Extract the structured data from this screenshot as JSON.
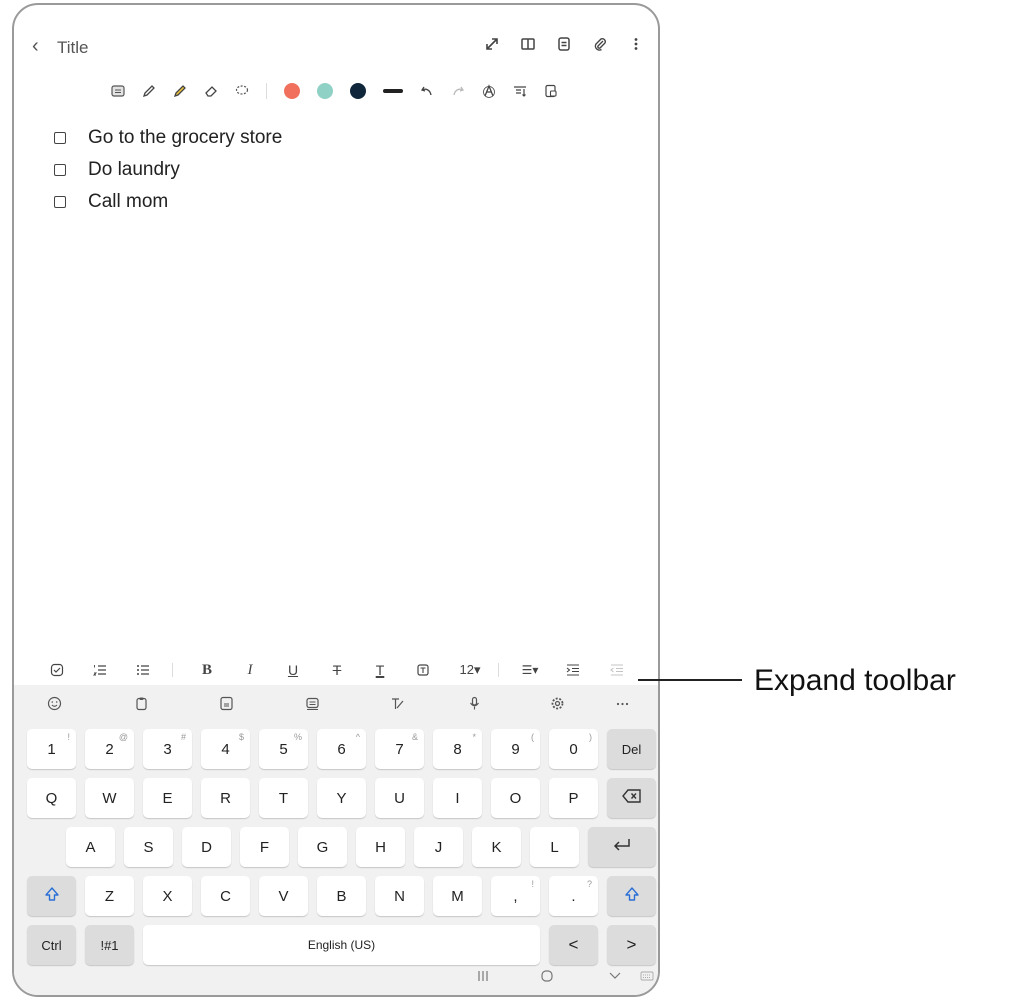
{
  "header": {
    "back_label": "‹",
    "title": "Title",
    "icons": [
      "expand-icon",
      "book-icon",
      "template-icon",
      "attach-icon",
      "more-vert-icon"
    ]
  },
  "draw_toolbar": {
    "icons": [
      "keyboard-mode-icon",
      "pen-icon",
      "highlighter-icon",
      "eraser-icon",
      "lasso-icon",
      "undo-icon",
      "redo-icon",
      "handwriting-icon",
      "text-convert-icon",
      "lock-icon"
    ],
    "colors": [
      "#f0705d",
      "#8fd1c4",
      "#10263a"
    ]
  },
  "note": {
    "items": [
      {
        "text": "Go to the grocery store",
        "checked": false
      },
      {
        "text": "Do laundry",
        "checked": false
      },
      {
        "text": "Call mom",
        "checked": false
      }
    ]
  },
  "format_toolbar": {
    "bold": "B",
    "italic": "I",
    "underline": "U",
    "strike": "T",
    "text_color": "T",
    "font_size": "12▾",
    "align": "☰▾"
  },
  "keyboard": {
    "row1": [
      {
        "k": "1",
        "s": "!"
      },
      {
        "k": "2",
        "s": "@"
      },
      {
        "k": "3",
        "s": "#"
      },
      {
        "k": "4",
        "s": "$"
      },
      {
        "k": "5",
        "s": "%"
      },
      {
        "k": "6",
        "s": "^"
      },
      {
        "k": "7",
        "s": "&"
      },
      {
        "k": "8",
        "s": "*"
      },
      {
        "k": "9",
        "s": "("
      },
      {
        "k": "0",
        "s": ")"
      },
      {
        "k": "Del",
        "s": ""
      }
    ],
    "row2": [
      "Q",
      "W",
      "E",
      "R",
      "T",
      "Y",
      "U",
      "I",
      "O",
      "P"
    ],
    "row3": [
      "A",
      "S",
      "D",
      "F",
      "G",
      "H",
      "J",
      "K",
      "L"
    ],
    "row4": [
      "Z",
      "X",
      "C",
      "V",
      "B",
      "N",
      "M"
    ],
    "comma": {
      "k": ",",
      "s": "!"
    },
    "period": {
      "k": ".",
      "s": "?"
    },
    "ctrl": "Ctrl",
    "symbols": "!#1",
    "space": "English (US)",
    "left_arrow": "<",
    "right_arrow": ">"
  },
  "callout": {
    "label": "Expand toolbar"
  }
}
